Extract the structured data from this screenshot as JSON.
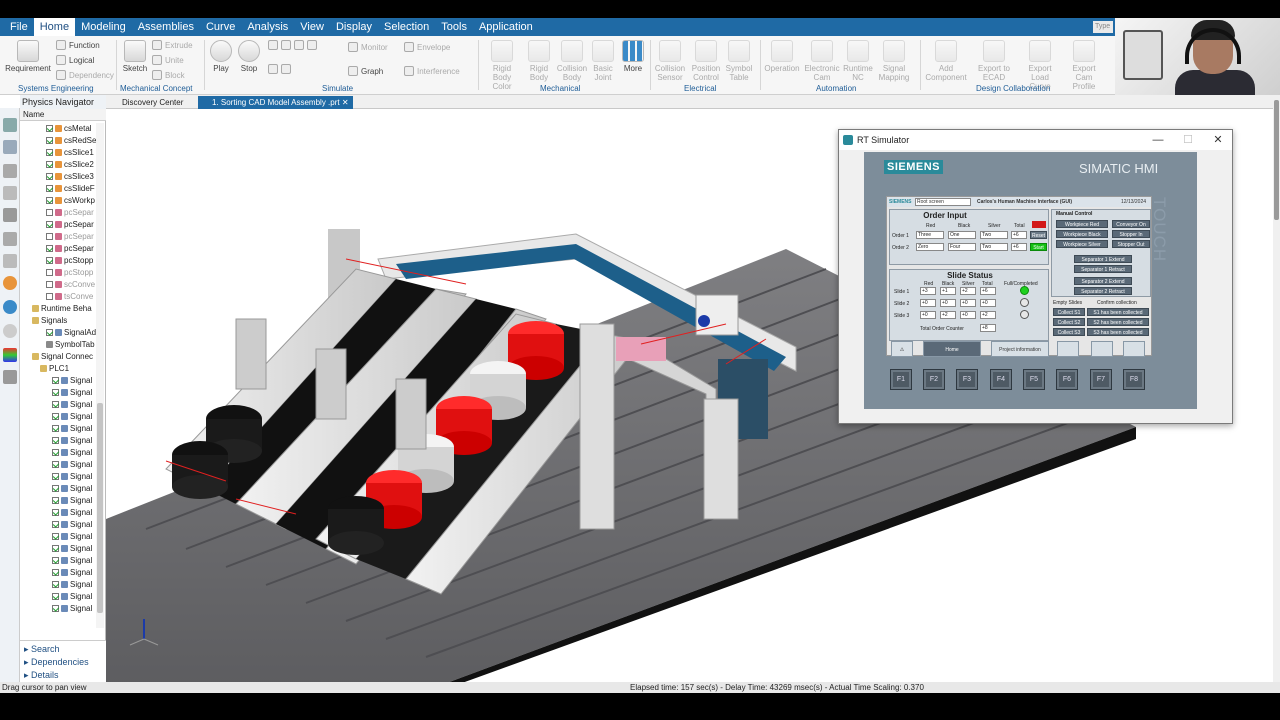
{
  "menu": {
    "items": [
      "File",
      "Home",
      "Modeling",
      "Assemblies",
      "Curve",
      "Analysis",
      "View",
      "Display",
      "Selection",
      "Tools",
      "Application"
    ],
    "active": "Home",
    "search_placeholder": "Type"
  },
  "ribbon": {
    "requirement": "Requirement",
    "function": "Function",
    "logical": "Logical",
    "dependency": "Dependency",
    "sketch": "Sketch",
    "extrude": "Extrude",
    "unite": "Unite",
    "block": "Block",
    "play": "Play",
    "stop": "Stop",
    "monitor": "Monitor",
    "envelope": "Envelope",
    "graph": "Graph",
    "interference": "Interference",
    "rigid_body_color": "Rigid Body Color",
    "rigid_body": "Rigid Body",
    "collision_body": "Collision Body",
    "basic_joint": "Basic Joint",
    "more": "More",
    "collision_sensor": "Collision Sensor",
    "position_control": "Position Control",
    "symbol_table": "Symbol Table",
    "operation": "Operation",
    "electronic_cam": "Electronic Cam",
    "runtime_nc": "Runtime NC",
    "signal_mapping": "Signal Mapping",
    "add_component": "Add Component",
    "export_to_ecad": "Export to ECAD",
    "export_load_curve": "Export Load Curve",
    "export_cam_profile": "Export Cam Profile",
    "groups": [
      "Systems Engineering",
      "Mechanical Concept",
      "Simulate",
      "Mechanical",
      "Electrical",
      "Automation",
      "Design Collaboration"
    ]
  },
  "navigator": {
    "title": "Physics Navigator",
    "column": "Name",
    "rows": [
      {
        "label": "csMetal",
        "checked": true,
        "dim": false,
        "icon": "orange"
      },
      {
        "label": "csRedSe",
        "checked": true,
        "dim": false,
        "icon": "orange"
      },
      {
        "label": "csSlice1",
        "checked": true,
        "dim": false,
        "icon": "orange"
      },
      {
        "label": "csSlice2",
        "checked": true,
        "dim": false,
        "icon": "orange"
      },
      {
        "label": "csSlice3",
        "checked": true,
        "dim": false,
        "icon": "orange"
      },
      {
        "label": "csSlideF",
        "checked": true,
        "dim": false,
        "icon": "orange"
      },
      {
        "label": "csWorkp",
        "checked": true,
        "dim": false,
        "icon": "orange"
      },
      {
        "label": "pcSepar",
        "checked": false,
        "dim": true,
        "icon": "pink"
      },
      {
        "label": "pcSepar",
        "checked": true,
        "dim": false,
        "icon": "pink"
      },
      {
        "label": "pcSepar",
        "checked": false,
        "dim": true,
        "icon": "pink"
      },
      {
        "label": "pcSepar",
        "checked": true,
        "dim": false,
        "icon": "pink"
      },
      {
        "label": "pcStopp",
        "checked": true,
        "dim": false,
        "icon": "pink"
      },
      {
        "label": "pcStopp",
        "checked": false,
        "dim": true,
        "icon": "pink"
      },
      {
        "label": "scConve",
        "checked": false,
        "dim": true,
        "icon": "pink"
      },
      {
        "label": "tsConve",
        "checked": false,
        "dim": true,
        "icon": "pink"
      },
      {
        "label": "Runtime Beha",
        "checked": null,
        "dim": false,
        "icon": "folder"
      },
      {
        "label": "Signals",
        "checked": null,
        "dim": false,
        "icon": "folder"
      },
      {
        "label": "SignalAd",
        "checked": true,
        "dim": false,
        "icon": "signal"
      },
      {
        "label": "SymbolTab",
        "checked": null,
        "dim": false,
        "icon": "table"
      },
      {
        "label": "Signal Connec",
        "checked": null,
        "dim": false,
        "icon": "folder"
      },
      {
        "label": "PLC1",
        "checked": null,
        "dim": false,
        "icon": "folder"
      },
      {
        "label": "Signal",
        "checked": true,
        "dim": false,
        "icon": "signal"
      },
      {
        "label": "Signal",
        "checked": true,
        "dim": false,
        "icon": "signal"
      },
      {
        "label": "Signal",
        "checked": true,
        "dim": false,
        "icon": "signal"
      },
      {
        "label": "Signal",
        "checked": true,
        "dim": false,
        "icon": "signal"
      },
      {
        "label": "Signal",
        "checked": true,
        "dim": false,
        "icon": "signal"
      },
      {
        "label": "Signal",
        "checked": true,
        "dim": false,
        "icon": "signal"
      },
      {
        "label": "Signal",
        "checked": true,
        "dim": false,
        "icon": "signal"
      },
      {
        "label": "Signal",
        "checked": true,
        "dim": false,
        "icon": "signal"
      },
      {
        "label": "Signal",
        "checked": true,
        "dim": false,
        "icon": "signal"
      },
      {
        "label": "Signal",
        "checked": true,
        "dim": false,
        "icon": "signal"
      },
      {
        "label": "Signal",
        "checked": true,
        "dim": false,
        "icon": "signal"
      },
      {
        "label": "Signal",
        "checked": true,
        "dim": false,
        "icon": "signal"
      },
      {
        "label": "Signal",
        "checked": true,
        "dim": false,
        "icon": "signal"
      },
      {
        "label": "Signal",
        "checked": true,
        "dim": false,
        "icon": "signal"
      },
      {
        "label": "Signal",
        "checked": true,
        "dim": false,
        "icon": "signal"
      },
      {
        "label": "Signal",
        "checked": true,
        "dim": false,
        "icon": "signal"
      },
      {
        "label": "Signal",
        "checked": true,
        "dim": false,
        "icon": "signal"
      },
      {
        "label": "Signal",
        "checked": true,
        "dim": false,
        "icon": "signal"
      },
      {
        "label": "Signal",
        "checked": true,
        "dim": false,
        "icon": "signal"
      },
      {
        "label": "Signal",
        "checked": true,
        "dim": false,
        "icon": "signal"
      }
    ],
    "bottom": [
      "Search",
      "Dependencies",
      "Details"
    ]
  },
  "tabs": {
    "discovery": "Discovery Center",
    "model": "1. Sorting CAD Model Assembly .prt"
  },
  "status": {
    "left": "Drag cursor to pan view",
    "right": "Elapsed time: 157 sec(s) - Delay Time: 43269 msec(s) - Actual Time Scaling: 0.370"
  },
  "sim": {
    "title": "RT Simulator",
    "brand": "SIEMENS",
    "product": "SIMATIC HMI",
    "touch": "TOUCH",
    "screen_brand": "SIEMENS",
    "screen_sub": "SIMATIC HMI",
    "root_screen": "Root screen",
    "gui_title": "Carlos's Human Machine Interface (GUI)",
    "date": "12/13/2024",
    "order_input": {
      "title": "Order Input",
      "headers": [
        "Red",
        "Black",
        "Silver",
        "Total"
      ],
      "rows": [
        {
          "label": "Order 1",
          "red": "Three",
          "black": "One",
          "silver": "Two",
          "total": "+6",
          "btn": "Reset"
        },
        {
          "label": "Order 2",
          "red": "Zero",
          "black": "Four",
          "silver": "Two",
          "total": "+6",
          "btn": "Start"
        }
      ]
    },
    "slide_status": {
      "title": "Slide Status",
      "headers": [
        "Red",
        "Black",
        "Silver",
        "Total",
        "Full/Completed"
      ],
      "rows": [
        {
          "label": "Slide 1",
          "vals": [
            "+3",
            "+1",
            "+2",
            "+6"
          ]
        },
        {
          "label": "Slide 2",
          "vals": [
            "+0",
            "+0",
            "+0",
            "+0"
          ]
        },
        {
          "label": "Slide 3",
          "vals": [
            "+0",
            "+2",
            "+0",
            "+2"
          ]
        }
      ],
      "counter_label": "Total Order Counter",
      "counter_value": "+8"
    },
    "manual": {
      "title": "Manual Control",
      "buttons": [
        [
          "Workpiece Red",
          "Conveyor On"
        ],
        [
          "Workpiece Black",
          "Stopper In"
        ],
        [
          "Workpiece Silver",
          "Stopper Out"
        ]
      ],
      "separators": [
        "Separator 1 Extend",
        "Separator 1 Retract",
        "Separator 2 Extend",
        "Separator 2 Retract"
      ]
    },
    "collection": {
      "empty_label": "Empty Slides",
      "confirm_label": "Confirm collection",
      "rows": [
        {
          "btn": "Collect S1",
          "msg": "S1 has been collected"
        },
        {
          "btn": "Collect S2",
          "msg": "S2 has been collected"
        },
        {
          "btn": "Collect S3",
          "msg": "S3 has been collected"
        }
      ]
    },
    "nav": {
      "home": "Home",
      "project": "Project information"
    },
    "fkeys": [
      "F1",
      "F2",
      "F3",
      "F4",
      "F5",
      "F6",
      "F7",
      "F8"
    ]
  },
  "colors": {
    "menubar": "#1f6aa5",
    "conveyor": "#1d5f8a",
    "red_part": "#e01010",
    "black_part": "#1a1a1a",
    "silver_part": "#d4d4d4",
    "hmi_bezel": "#7d8d9a"
  }
}
